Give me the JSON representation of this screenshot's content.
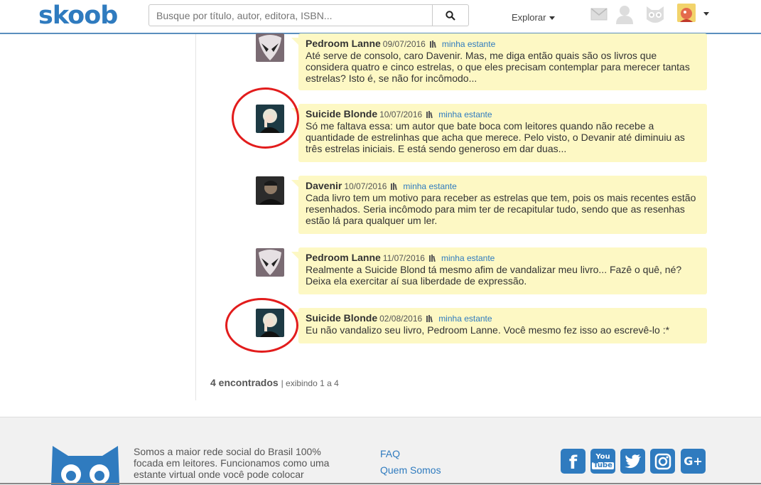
{
  "header": {
    "logo": "skoob",
    "search_placeholder": "Busque por título, autor, editora, ISBN...",
    "explore_label": "Explorar"
  },
  "comments": [
    {
      "user": "Pedroom Lanne",
      "date": "09/07/2016",
      "shelf": "minha estante",
      "text": "Até serve de consolo, caro Davenir. Mas, me diga então quais são os livros que considera quatro e cinco estrelas, o que eles precisam contemplar para merecer tantas estrelas? Isto é, se não for incômodo..."
    },
    {
      "user": "Suicide Blonde",
      "date": "10/07/2016",
      "shelf": "minha estante",
      "text": "Só me faltava essa: um autor que bate boca com leitores quando não recebe a quantidade de estrelinhas que acha que merece. Pelo visto, o Devanir até diminuiu as três estrelas iniciais. E está sendo generoso em dar duas..."
    },
    {
      "user": "Davenir",
      "date": "10/07/2016",
      "shelf": "minha estante",
      "text": "Cada livro tem um motivo para receber as estrelas que tem, pois os mais recentes estão resenhados. Seria incômodo para mim ter de recapitular tudo, sendo que as resenhas estão lá para qualquer um ler."
    },
    {
      "user": "Pedroom Lanne",
      "date": "11/07/2016",
      "shelf": "minha estante",
      "text": "Realmente a Suicide Blond tá mesmo afim de vandalizar meu livro... Fazê o quê, né? Deixa ela exercitar aí sua liberdade de expressão."
    },
    {
      "user": "Suicide Blonde",
      "date": "02/08/2016",
      "shelf": "minha estante",
      "text": "Eu não vandalizo seu livro, Pedroom Lanne. Você mesmo fez isso ao escrevê-lo :*"
    }
  ],
  "pager": {
    "count": "4 encontrados",
    "showing": "| exibindo 1 a 4"
  },
  "footer": {
    "about": "Somos a maior rede social do Brasil 100% focada em leitores. Funcionamos como uma estante virtual onde você pode colocar",
    "links": [
      "FAQ",
      "Quem Somos"
    ]
  },
  "colors": {
    "brand": "#2f7bbf",
    "bubble": "#fdf8c4",
    "highlight": "#e21c1c"
  }
}
